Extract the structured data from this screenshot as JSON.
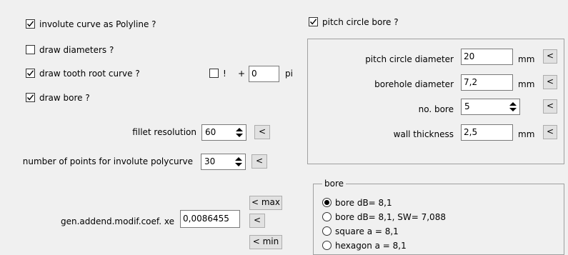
{
  "left": {
    "involute_polyline": {
      "label": "involute curve as Polyline ?",
      "checked": true
    },
    "draw_diameters": {
      "label": "draw diameters ?",
      "checked": false
    },
    "draw_root_curve": {
      "label": "draw tooth root curve ?",
      "checked": true
    },
    "exclaim_check": {
      "label": "!",
      "checked": false
    },
    "plus_label": "+",
    "pi_value": "0",
    "pi_unit": "pi",
    "draw_bore": {
      "label": "draw bore ?",
      "checked": true
    },
    "fillet": {
      "label": "fillet resolution",
      "value": "60",
      "button": "<"
    },
    "points": {
      "label": "number of points for involute polycurve",
      "value": "30",
      "button": "<"
    },
    "addend": {
      "label": "gen.addend.modif.coef. xe",
      "value": "0,0086455",
      "max_button": "< max",
      "mid_button": "<",
      "min_button": "< min"
    }
  },
  "right": {
    "pitch_circle_bore": {
      "label": "pitch circle bore ?",
      "checked": true
    },
    "pitch_diameter": {
      "label": "pitch circle diameter",
      "value": "20",
      "unit": "mm",
      "button": "<"
    },
    "borehole_diameter": {
      "label": "borehole diameter",
      "value": "7,2",
      "unit": "mm",
      "button": "<"
    },
    "no_bore": {
      "label": "no. bore",
      "value": "5",
      "button": "<"
    },
    "wall_thickness": {
      "label": "wall thickness",
      "value": "2,5",
      "unit": "mm",
      "button": "<"
    }
  },
  "bore_group": {
    "title": "bore",
    "options": [
      {
        "label": "bore dB= 8,1",
        "selected": true
      },
      {
        "label": "bore dB= 8,1, SW= 7,088",
        "selected": false
      },
      {
        "label": "square a = 8,1",
        "selected": false
      },
      {
        "label": "hexagon a = 8,1",
        "selected": false
      }
    ]
  }
}
